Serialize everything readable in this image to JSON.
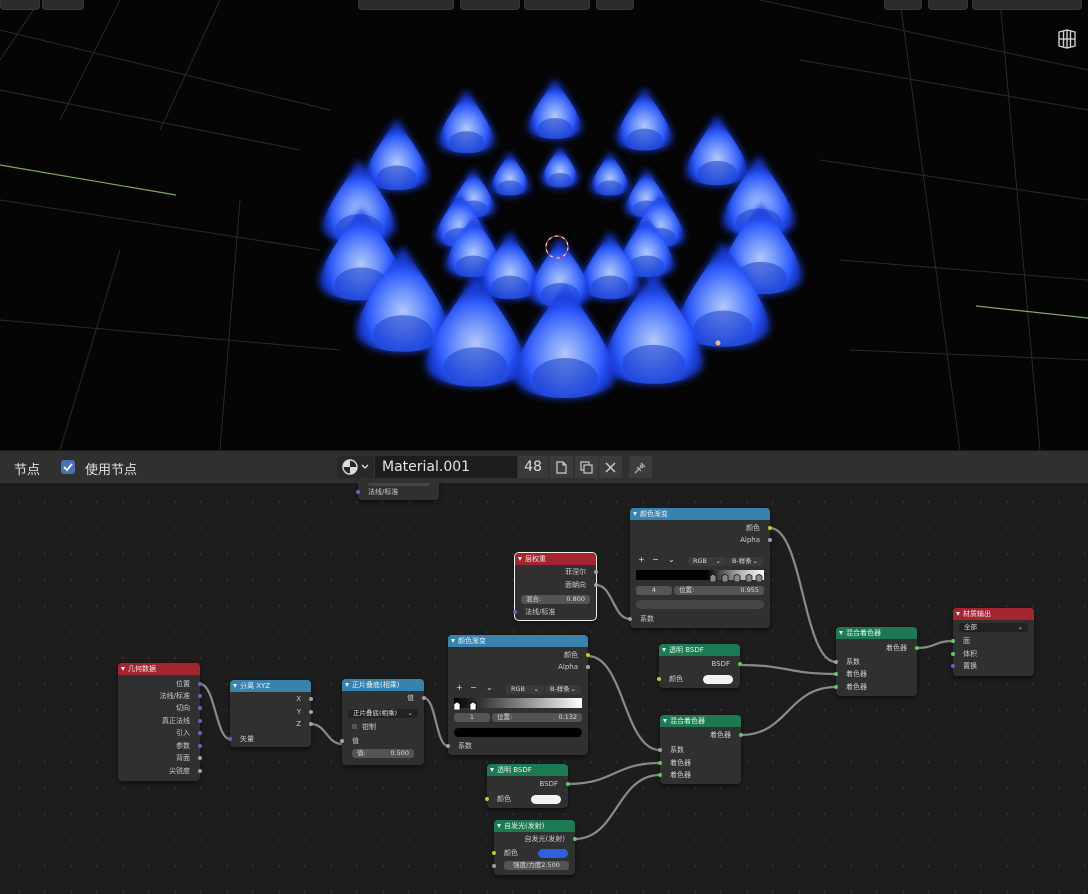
{
  "viewport": {
    "top_buttons": [
      "",
      "",
      "",
      "",
      "",
      "",
      ""
    ],
    "grid_icon": "view-grid-icon"
  },
  "header": {
    "menu_label": "节点",
    "use_nodes_label": "使用节点",
    "use_nodes_checked": true,
    "material_name": "Material.001",
    "user_count": "48",
    "icons": [
      "material-sphere-icon",
      "fake-user-icon",
      "duplicate-icon",
      "close-icon",
      "pin-icon"
    ]
  },
  "nodes": {
    "partial_top": {
      "output": "法线/标准"
    },
    "geometry": {
      "title": "几何数据",
      "outputs": [
        "位置",
        "法线/标准",
        "切向",
        "真正法线",
        "引入",
        "参数",
        "背面",
        "尖锐度"
      ]
    },
    "separate_xyz": {
      "title": "分离 XYZ",
      "outputs": [
        "X",
        "Y",
        "Z"
      ],
      "input": "矢量"
    },
    "math": {
      "title": "正片叠底(相乘)",
      "output": "值",
      "operation": "正片叠底(相乘)",
      "clamp_label": "钳制",
      "input_label": "值",
      "value_label": "值:",
      "value": "0.500"
    },
    "color_ramp_1": {
      "title": "颜色渐变",
      "outputs": [
        "颜色",
        "Alpha"
      ],
      "mode": "RGB",
      "interpolation": "B-样条",
      "index": "1",
      "position_label": "位置:",
      "position": "0.132",
      "input": "系数"
    },
    "layer_weight": {
      "title": "层权重",
      "outputs": [
        "菲涅尔",
        "面朝向"
      ],
      "blend_label": "混合:",
      "blend": "0.800",
      "input": "法线/标准"
    },
    "color_ramp_2": {
      "title": "颜色渐变",
      "outputs": [
        "颜色",
        "Alpha"
      ],
      "mode": "RGB",
      "interpolation": "B-样条",
      "index": "4",
      "position_label": "位置:",
      "position": "0.955",
      "input": "系数"
    },
    "transparent_1": {
      "title": "透明 BSDF",
      "output": "BSDF",
      "input": "颜色"
    },
    "transparent_2": {
      "title": "透明 BSDF",
      "output": "BSDF",
      "input": "颜色"
    },
    "emission": {
      "title": "自发光(发射)",
      "output": "自发光(发射)",
      "input": "颜色",
      "strength": "强度/力度2.500",
      "color": "#2f5fe0"
    },
    "mix_shader_1": {
      "title": "混合着色器",
      "output": "着色器",
      "inputs": [
        "系数",
        "着色器",
        "着色器"
      ]
    },
    "mix_shader_2": {
      "title": "混合着色器",
      "output": "着色器",
      "inputs": [
        "系数",
        "着色器",
        "着色器"
      ]
    },
    "material_output": {
      "title": "材质输出",
      "target": "全部",
      "inputs": [
        "面",
        "体积",
        "置换"
      ]
    }
  },
  "colors": {
    "accent": "#4772b3",
    "flame": "#2a5cff"
  }
}
